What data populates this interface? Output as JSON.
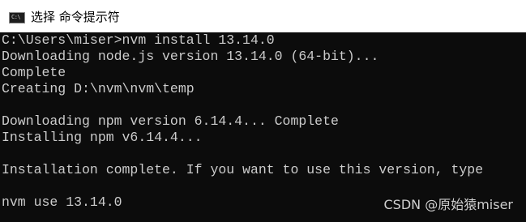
{
  "window": {
    "title": "选择 命令提示符",
    "icon": "cmd-prompt-icon",
    "icon_glyph": "C:\\"
  },
  "console": {
    "lines": [
      "C:\\Users\\miser>nvm install 13.14.0",
      "Downloading node.js version 13.14.0 (64-bit)...",
      "Complete",
      "Creating D:\\nvm\\nvm\\temp",
      "",
      "Downloading npm version 6.14.4... Complete",
      "Installing npm v6.14.4...",
      "",
      "Installation complete. If you want to use this version, type",
      "",
      "nvm use 13.14.0"
    ]
  },
  "watermark": "CSDN @原始猿miser",
  "colors": {
    "console_background": "#0c0c0c",
    "console_text": "#cccccc",
    "titlebar_background": "#ffffff"
  }
}
